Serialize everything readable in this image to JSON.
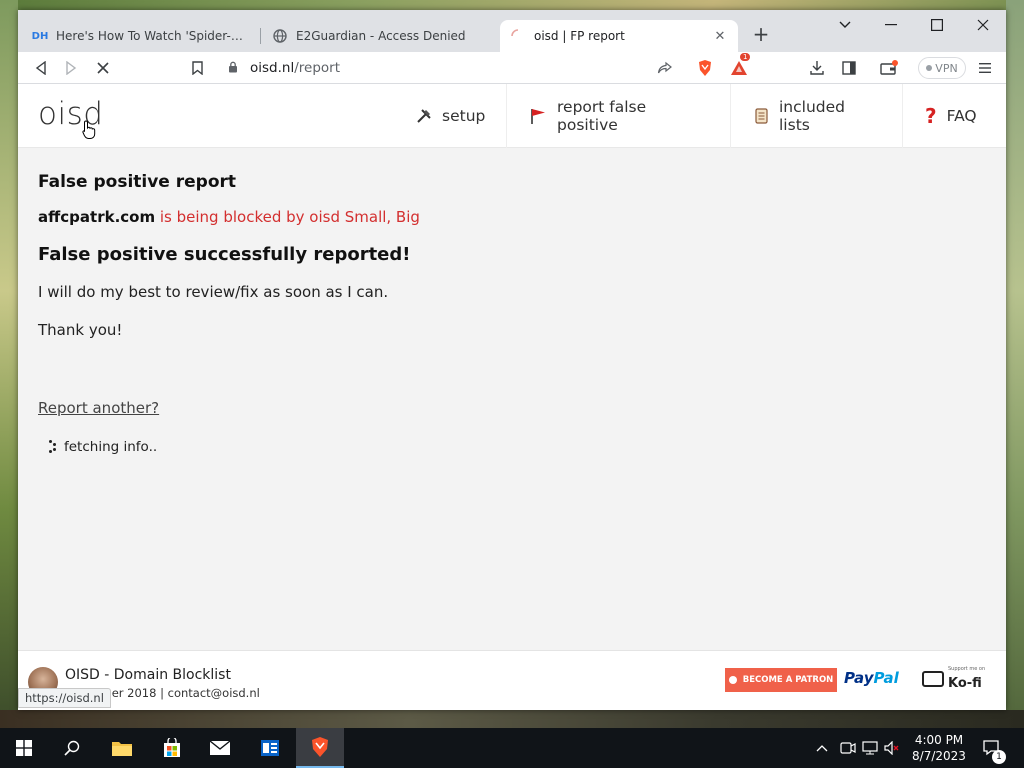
{
  "browser": {
    "tabs": [
      {
        "favicon": "DH",
        "title": "Here's How To Watch 'Spider-Man: Ac"
      },
      {
        "favicon": "globe-icon",
        "title": "E2Guardian - Access Denied"
      },
      {
        "favicon": "loading-icon",
        "title": "oisd | FP report"
      }
    ],
    "address": {
      "host": "oisd.nl",
      "path": "/report"
    },
    "vpn_label": "VPN",
    "rewards_badge": "1",
    "status_url": "https://oisd.nl"
  },
  "site": {
    "logo": "oisd",
    "nav": [
      {
        "icon": "tools-icon",
        "label": "setup"
      },
      {
        "icon": "flag-icon",
        "label": "report false positive"
      },
      {
        "icon": "scroll-icon",
        "label": "included lists"
      },
      {
        "icon": "question-icon",
        "label": "FAQ"
      }
    ]
  },
  "report": {
    "title": "False positive report",
    "domain": "affcpatrk.com",
    "blocked_message": "is being blocked by oisd Small, Big",
    "success": "False positive successfully reported!",
    "review_text": "I will do my best to review/fix as soon as I can.",
    "thanks": "Thank you!",
    "report_another": "Report another?",
    "fetching": "fetching info.."
  },
  "footer": {
    "title": "OISD - Domain Blocklist",
    "subtitle": "november 2018 | contact@oisd.nl",
    "patreon_label": "BECOME A PATRON",
    "paypal_a": "Pay",
    "paypal_b": "Pal",
    "kofi_small": "Support me on",
    "kofi_label": "Ko-fi"
  },
  "taskbar": {
    "time": "4:00 PM",
    "date": "8/7/2023",
    "notification_count": "1"
  }
}
